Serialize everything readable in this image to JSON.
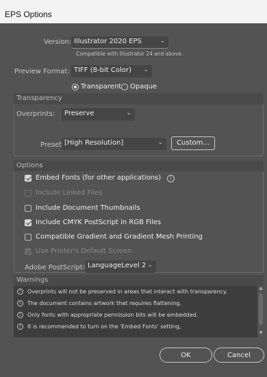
{
  "window": {
    "title": "EPS Options"
  },
  "version": {
    "label": "Version:",
    "value": "Illustrator 2020 EPS",
    "note": "Compatible with Illustrator 24 and above."
  },
  "preview": {
    "label": "Preview Format:",
    "value": "TIFF (8-bit Color)",
    "background_options": [
      "Transparent",
      "Opaque"
    ],
    "selected": "Transparent"
  },
  "transparency": {
    "heading": "Transparency",
    "overprints_label": "Overprints:",
    "overprints_value": "Preserve",
    "preset_label": "Preset:",
    "preset_value": "[High Resolution]",
    "custom_button": "Custom..."
  },
  "options": {
    "heading": "Options",
    "items": [
      {
        "label": "Embed Fonts (for other applications)",
        "checked": true,
        "enabled": true
      },
      {
        "label": "Include Linked Files",
        "checked": false,
        "enabled": false
      },
      {
        "label": "Include Document Thumbnails",
        "checked": false,
        "enabled": true
      },
      {
        "label": "Include CMYK PostScript in RGB Files",
        "checked": true,
        "enabled": true
      },
      {
        "label": "Compatible Gradient and Gradient Mesh Printing",
        "checked": false,
        "enabled": true
      },
      {
        "label": "Use Printer's Default Screen",
        "checked": true,
        "enabled": false
      }
    ],
    "postscript_label": "Adobe PostScript®:",
    "postscript_value": "LanguageLevel 2"
  },
  "warnings": {
    "heading": "Warnings",
    "items": [
      "Overprints will not be preserved in areas that interact with transparency.",
      "The document contains artwork that requires flattening.",
      "Only fonts with appropriate permission bits will be embedded.",
      "It is recommended to turn on the 'Embed Fonts' setting,"
    ]
  },
  "buttons": {
    "ok": "OK",
    "cancel": "Cancel"
  },
  "colors": {
    "background": "#535353",
    "titlebar": "#f3f3f3",
    "field": "#454545",
    "warnings_bg": "#3d3d3d"
  }
}
